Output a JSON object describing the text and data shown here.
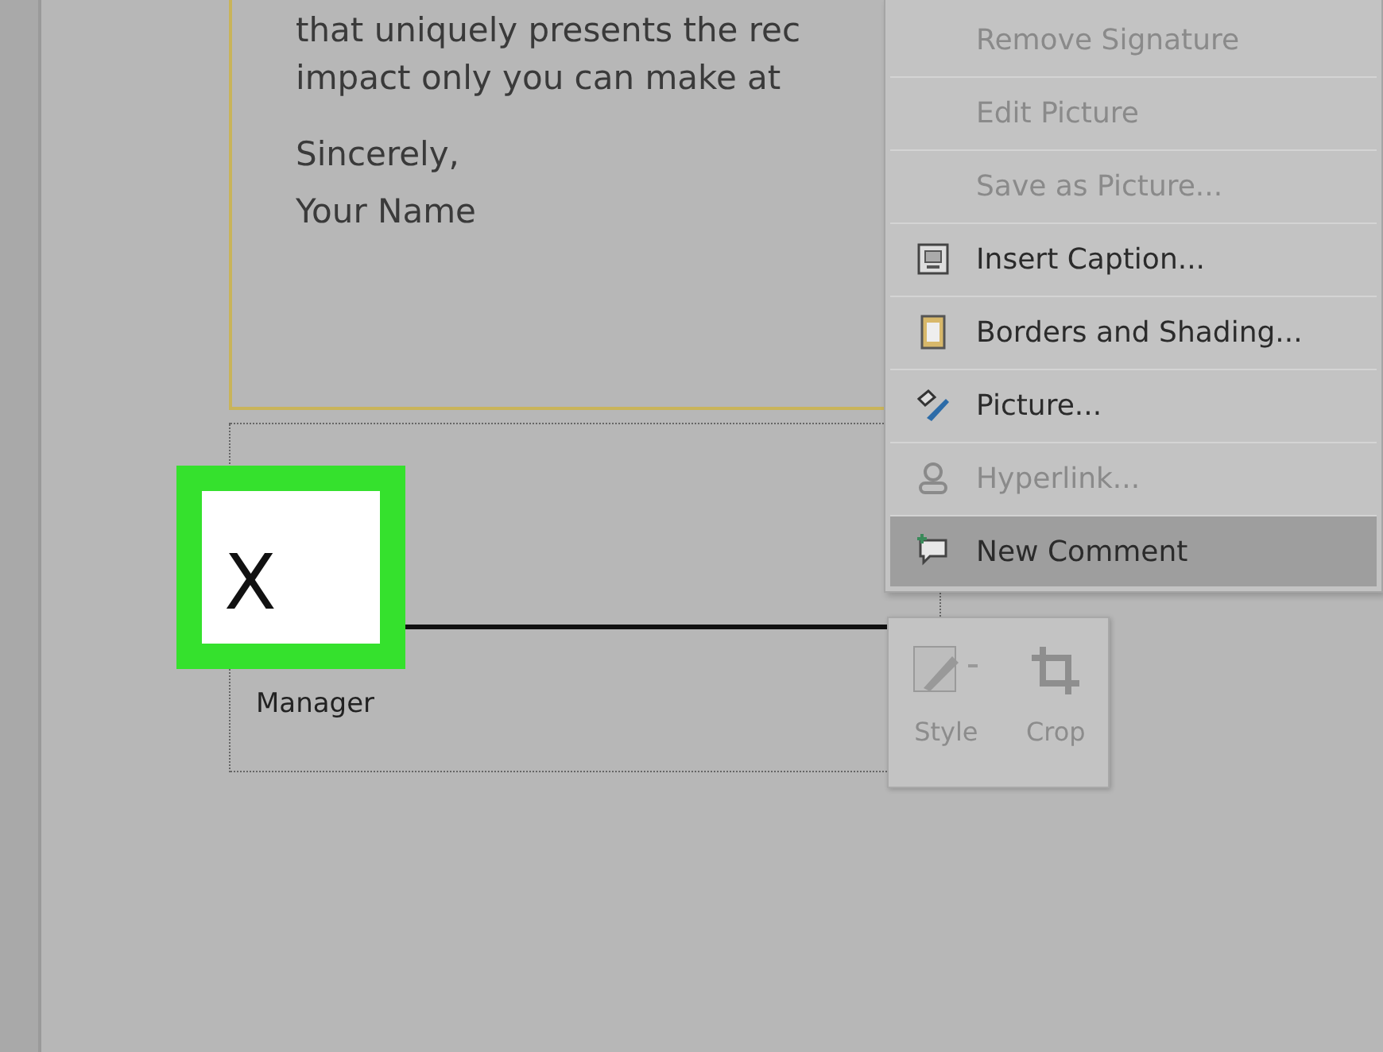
{
  "letter": {
    "lines": [
      "that uniquely presents the rec",
      "impact only you can make at"
    ],
    "closing": "Sincerely,",
    "name": "Your Name"
  },
  "signature": {
    "mark": "X",
    "title": "Manager",
    "highlighted": true
  },
  "context_menu": {
    "items": [
      {
        "label": "Remove Signature",
        "kind": "plain",
        "disabled": true,
        "selected": false
      },
      {
        "label": "Edit Picture",
        "kind": "plain",
        "disabled": true,
        "selected": false
      },
      {
        "label": "Save as Picture...",
        "kind": "plain",
        "disabled": true,
        "selected": false
      },
      {
        "label": "Insert Caption...",
        "kind": "caption",
        "disabled": false,
        "selected": false
      },
      {
        "label": "Borders and Shading...",
        "kind": "borders",
        "disabled": false,
        "selected": false
      },
      {
        "label": "Picture...",
        "kind": "picture",
        "disabled": false,
        "selected": false
      },
      {
        "label": "Hyperlink...",
        "kind": "link",
        "disabled": true,
        "selected": false
      },
      {
        "label": "New Comment",
        "kind": "comment",
        "disabled": false,
        "selected": true
      }
    ]
  },
  "mini_toolbar": {
    "buttons": [
      {
        "label": "Style",
        "kind": "style",
        "disabled": true
      },
      {
        "label": "Crop",
        "kind": "crop",
        "disabled": true
      }
    ]
  }
}
